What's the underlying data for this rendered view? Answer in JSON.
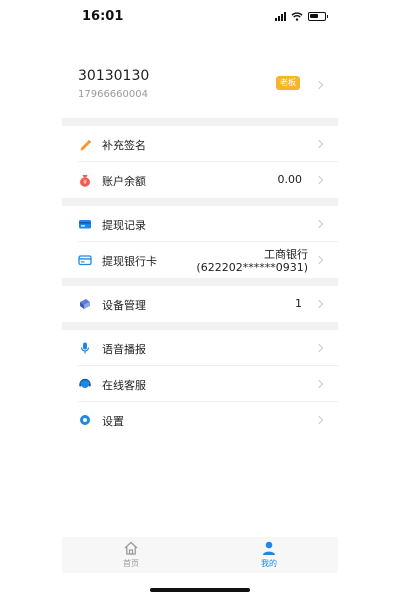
{
  "status_bar": {
    "time": "16:01"
  },
  "user": {
    "id": "30130130",
    "phone": "17966660004",
    "role_badge": "老板"
  },
  "menu": {
    "supplement_signature": {
      "label": "补充签名"
    },
    "account_balance": {
      "label": "账户余额",
      "value": "0.00"
    },
    "withdraw_records": {
      "label": "提现记录"
    },
    "withdraw_bank_card": {
      "label": "提现银行卡",
      "bank_name": "工商银行",
      "card_number": "(622202******0931)"
    },
    "device_management": {
      "label": "设备管理",
      "value": "1"
    },
    "voice_broadcast": {
      "label": "语音播报"
    },
    "online_service": {
      "label": "在线客服"
    },
    "settings": {
      "label": "设置"
    }
  },
  "tabs": [
    {
      "label": "首页",
      "icon": "home-icon",
      "active": false
    },
    {
      "label": "我的",
      "icon": "person-icon",
      "active": true
    }
  ],
  "colors": {
    "accent_blue": "#1e88e5",
    "badge_orange": "#f7b52c",
    "inactive_gray": "#9a9a9a",
    "section_gap": "#f2f2f4"
  }
}
